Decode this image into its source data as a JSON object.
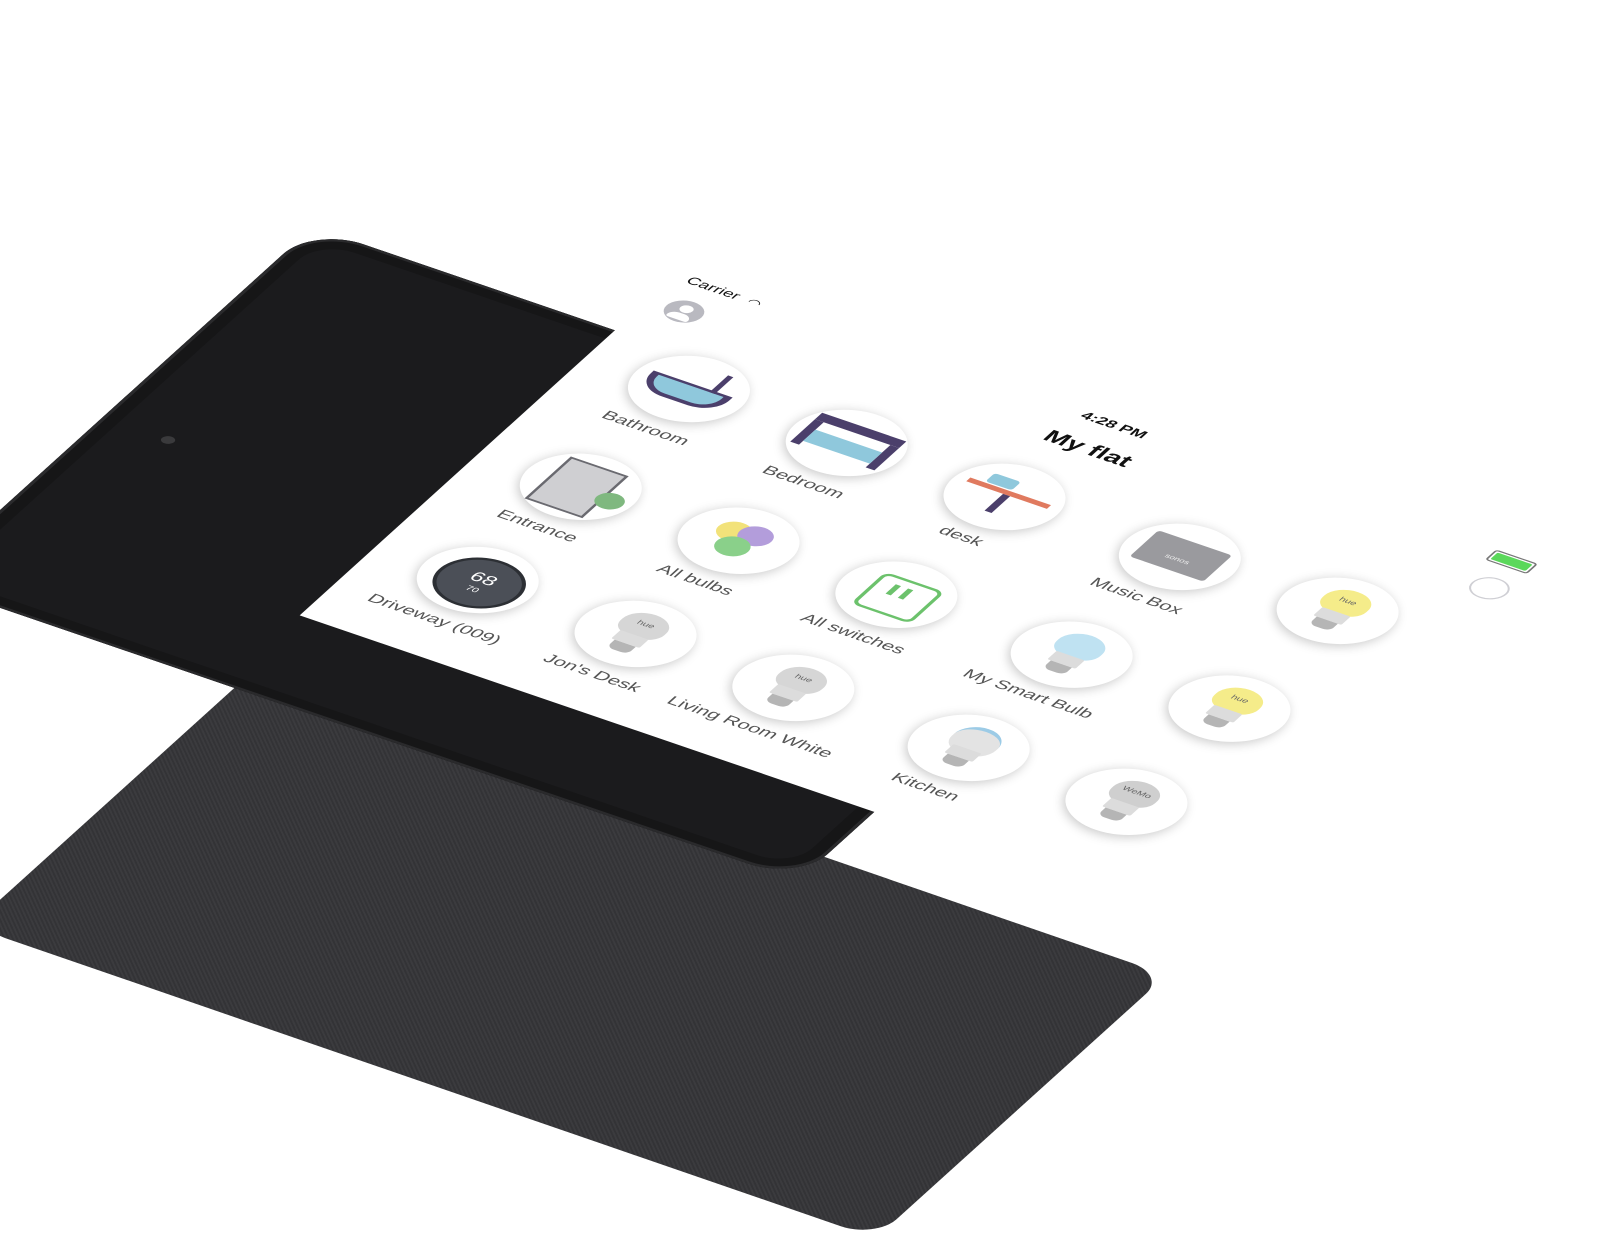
{
  "status_bar": {
    "carrier": "Carrier",
    "time": "4:28 PM"
  },
  "nav": {
    "title": "My flat"
  },
  "colors": {
    "battery": "#5bd85b",
    "tablet_body": "#1b1b1d",
    "screen": "#ffffff",
    "label": "#555555"
  },
  "tiles": [
    {
      "label": "Bathroom",
      "icon": "bathtub-icon"
    },
    {
      "label": "Bedroom",
      "icon": "bed-icon"
    },
    {
      "label": "desk",
      "icon": "desk-icon"
    },
    {
      "label": "Entrance",
      "icon": "door-icon"
    },
    {
      "label": "All bulbs",
      "icon": "bulbs-group-icon"
    },
    {
      "label": "All switches",
      "icon": "switch-icon"
    },
    {
      "label": "Driveway (009)",
      "icon": "thermostat-icon",
      "readout": "68",
      "sub_readout": "70"
    },
    {
      "label": "Jon's Desk",
      "icon": "bulb-icon",
      "mark": "hue"
    },
    {
      "label": "Living Room White",
      "icon": "bulb-icon",
      "mark": "hue"
    },
    {
      "label": "My Smart Bulb",
      "icon": "smart-bulb-icon"
    },
    {
      "label": "Kitchen",
      "icon": "smart-bulb-icon"
    },
    {
      "label": "Music Box",
      "icon": "speaker-icon",
      "mark": "sonos"
    },
    {
      "label": "",
      "icon": "bulb-icon",
      "mark": "WeMo"
    },
    {
      "label": "",
      "icon": "bulb-icon",
      "mark": "hue"
    },
    {
      "label": "",
      "icon": "bulb-icon",
      "mark": "hue"
    }
  ]
}
